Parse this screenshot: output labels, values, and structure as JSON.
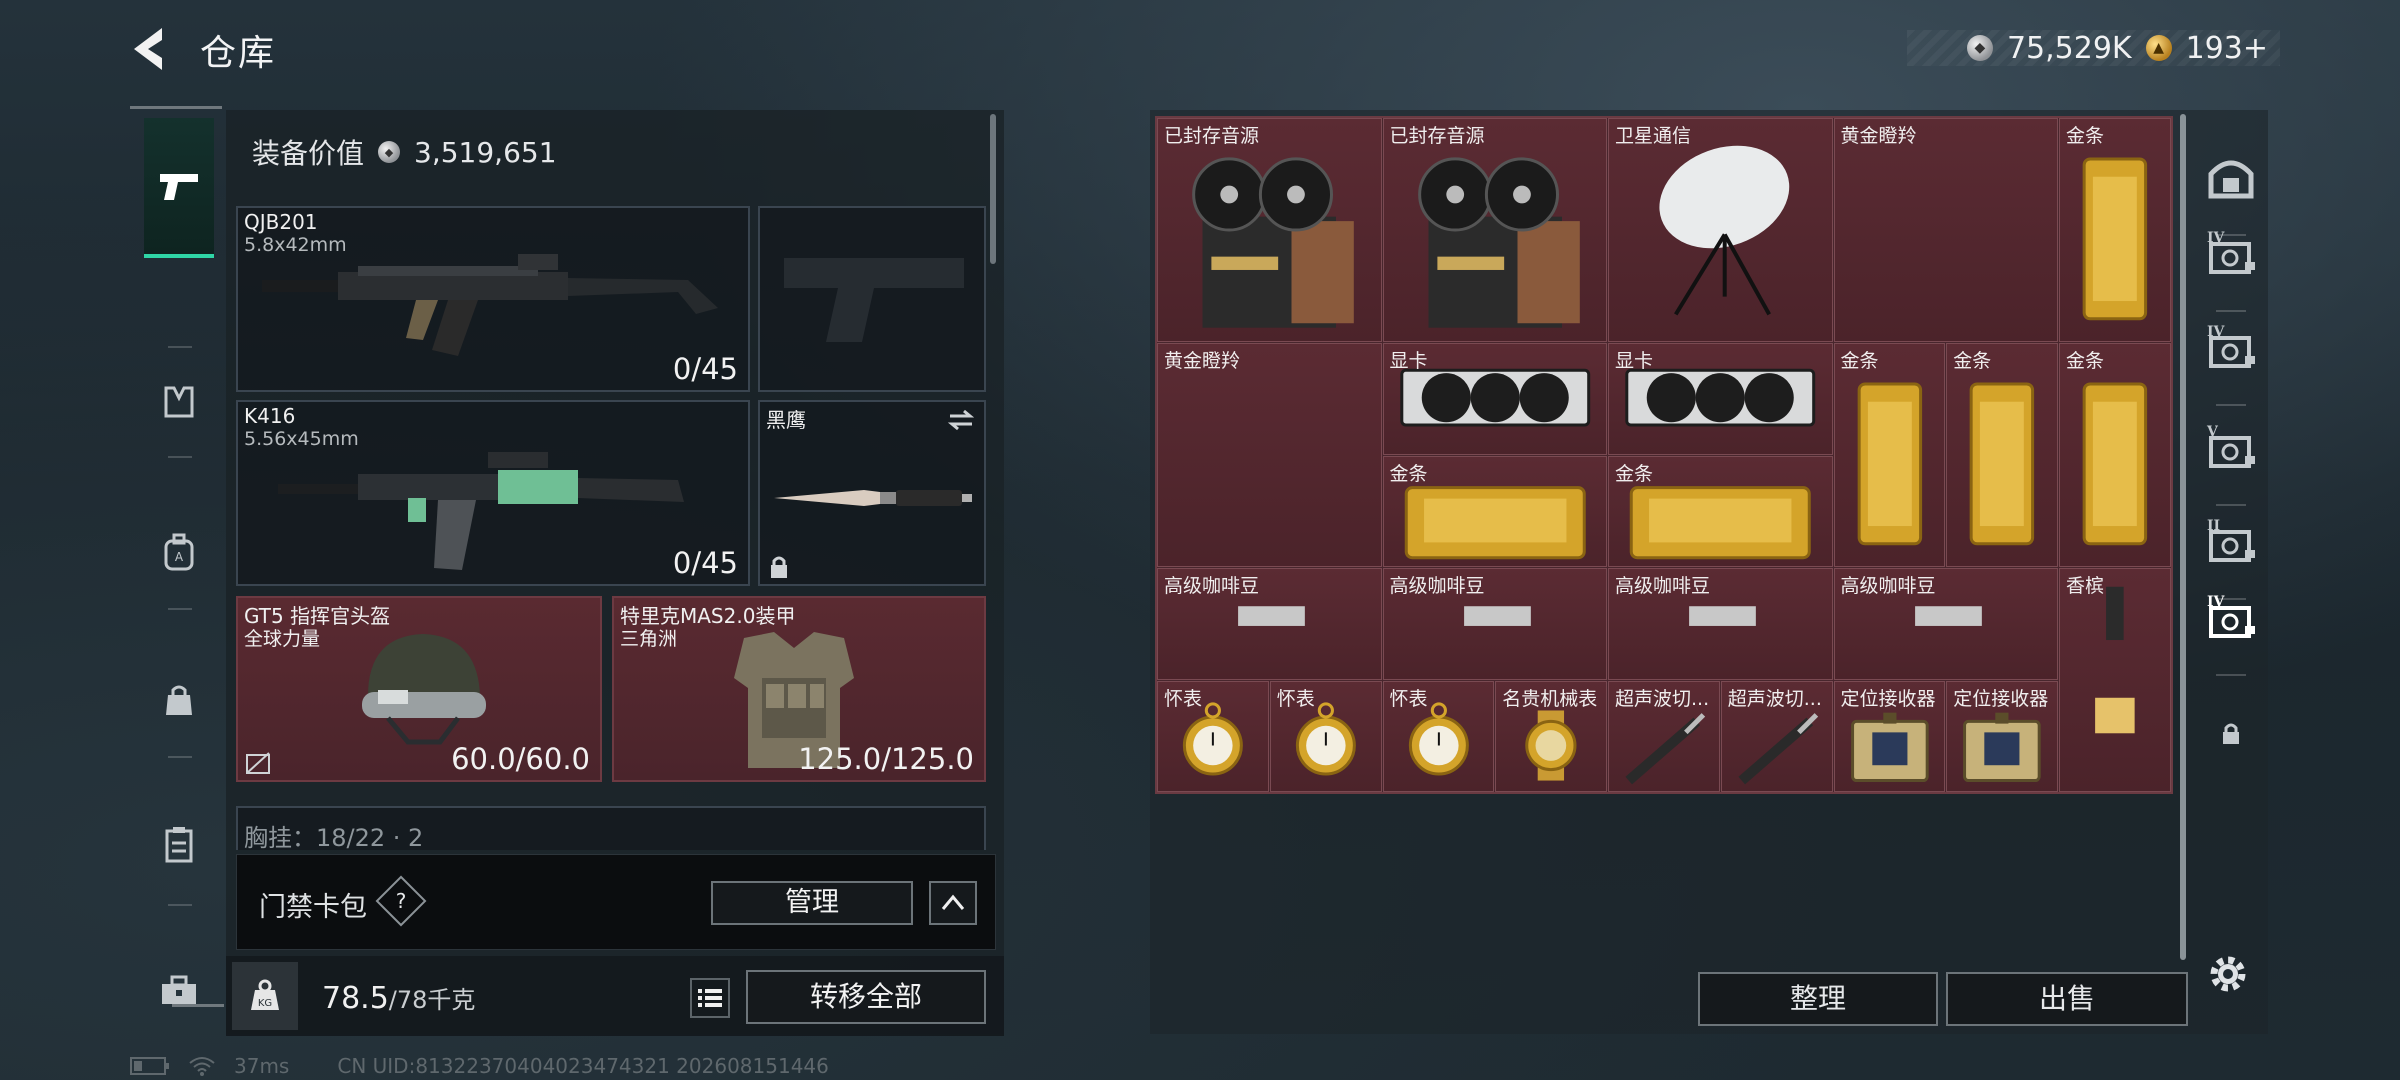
{
  "header": {
    "title": "仓库",
    "currency_silver": "75,529K",
    "currency_gold": "193+"
  },
  "left_nav": {
    "items": [
      {
        "icon": "pistol-icon",
        "active": true
      },
      {
        "icon": "vest-icon"
      },
      {
        "icon": "backpack-icon"
      },
      {
        "icon": "bag-icon"
      },
      {
        "icon": "clipboard-icon"
      },
      {
        "icon": "toolbox-icon"
      }
    ]
  },
  "equipment": {
    "value_label": "装备价值",
    "value": "3,519,651",
    "primary_weapon": {
      "name": "QJB201",
      "caliber": "5.8x42mm",
      "ammo": "0/45"
    },
    "secondary_weapon": {
      "name": "K416",
      "caliber": "5.56x45mm",
      "ammo": "0/45"
    },
    "melee": {
      "name": "黑鹰"
    },
    "helmet": {
      "name": "GT5 指挥官头盔",
      "sub": "全球力量",
      "durability": "60.0/60.0"
    },
    "armor": {
      "name": "特里克MAS2.0装甲",
      "sub": "三角洲",
      "durability": "125.0/125.0"
    },
    "chest_rig_partial": "胸挂：18/22 · 2"
  },
  "access_card": {
    "label": "门禁卡包",
    "help": "?",
    "manage_label": "管理"
  },
  "weight": {
    "current": "78.5",
    "max": "/78千克",
    "transfer_label": "转移全部"
  },
  "status": {
    "ping": "37ms",
    "uid": "CN UID:8132237040402347432​1 202608151446"
  },
  "storage": {
    "items": [
      {
        "label": "已封存音源",
        "kind": "tape"
      },
      {
        "label": "已封存音源",
        "kind": "tape"
      },
      {
        "label": "卫星通信",
        "kind": "dish"
      },
      {
        "label": "黄金瞪羚",
        "kind": "deer"
      },
      {
        "label": "金条",
        "kind": "goldbar-v"
      },
      {
        "label": "黄金瞪羚",
        "kind": "deer"
      },
      {
        "label": "显卡",
        "kind": "gpu"
      },
      {
        "label": "显卡",
        "kind": "gpu"
      },
      {
        "label": "金条",
        "kind": "goldbar-v"
      },
      {
        "label": "金条",
        "kind": "goldbar-v"
      },
      {
        "label": "金条",
        "kind": "goldbar-v"
      },
      {
        "label": "金条",
        "kind": "goldbar-h"
      },
      {
        "label": "金条",
        "kind": "goldbar-h"
      },
      {
        "label": "高级咖啡豆",
        "kind": "coffee"
      },
      {
        "label": "高级咖啡豆",
        "kind": "coffee"
      },
      {
        "label": "高级咖啡豆",
        "kind": "coffee"
      },
      {
        "label": "高级咖啡豆",
        "kind": "coffee"
      },
      {
        "label": "香槟",
        "kind": "champagne"
      },
      {
        "label": "怀表",
        "kind": "watch"
      },
      {
        "label": "怀表",
        "kind": "watch"
      },
      {
        "label": "怀表",
        "kind": "watch"
      },
      {
        "label": "名贵机械表",
        "kind": "wristwatch"
      },
      {
        "label": "超声波切...",
        "kind": "cutter"
      },
      {
        "label": "超声波切...",
        "kind": "cutter"
      },
      {
        "label": "定位接收器",
        "kind": "receiver"
      },
      {
        "label": "定位接收器",
        "kind": "receiver"
      }
    ],
    "sort_label": "整理",
    "sell_label": "出售"
  },
  "right_tabs": [
    {
      "icon": "safebox-icon",
      "label": ""
    },
    {
      "icon": "storage-tab-icon",
      "label": "IV"
    },
    {
      "icon": "storage-tab-icon",
      "label": "IV"
    },
    {
      "icon": "storage-tab-icon",
      "label": "V"
    },
    {
      "icon": "storage-tab-icon",
      "label": "II"
    },
    {
      "icon": "storage-tab-icon",
      "label": "IV",
      "active": true
    },
    {
      "icon": "lock-icon",
      "label": ""
    }
  ],
  "colors": {
    "accent_green": "#2fd6a6",
    "item_bg": "#4b232a",
    "gold": "#d4a42a"
  }
}
